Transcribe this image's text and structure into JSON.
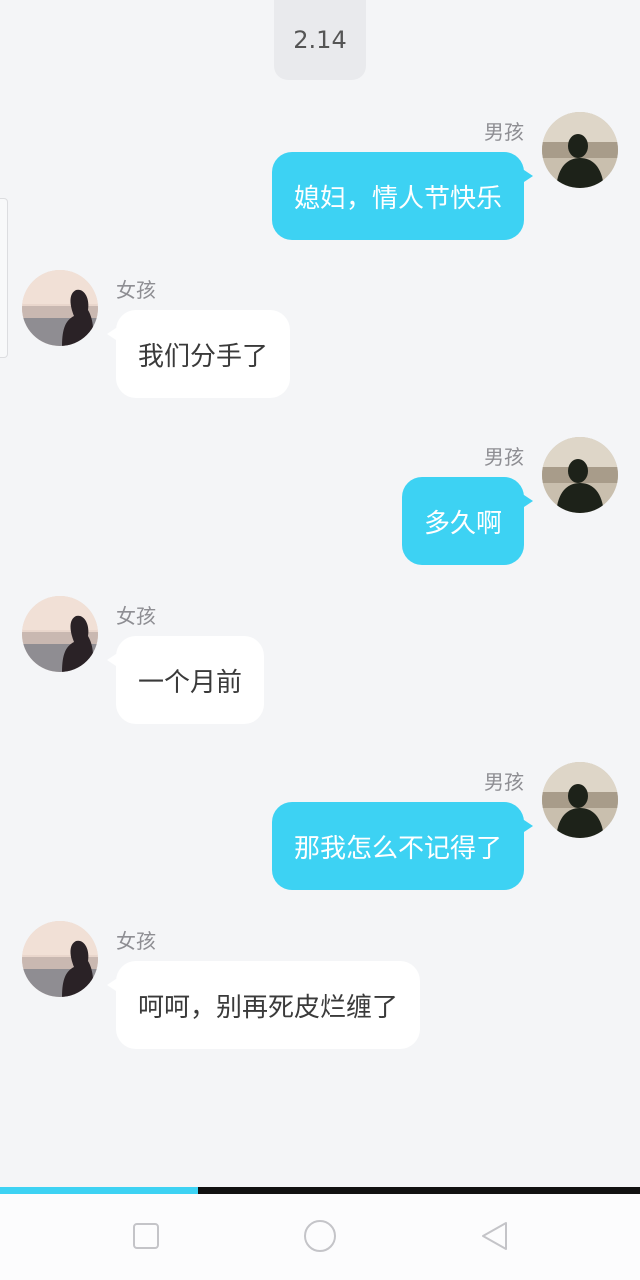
{
  "date_chip": "2.14",
  "messages": [
    {
      "side": "out",
      "sender": "男孩",
      "text": "媳妇，情人节快乐",
      "avatar": "boy-avatar"
    },
    {
      "side": "in",
      "sender": "女孩",
      "text": "我们分手了",
      "avatar": "girl-avatar"
    },
    {
      "side": "out",
      "sender": "男孩",
      "text": "多久啊",
      "avatar": "boy-avatar"
    },
    {
      "side": "in",
      "sender": "女孩",
      "text": "一个月前",
      "avatar": "girl-avatar"
    },
    {
      "side": "out",
      "sender": "男孩",
      "text": "那我怎么不记得了",
      "avatar": "boy-avatar"
    },
    {
      "side": "in",
      "sender": "女孩",
      "text": "呵呵，别再死皮烂缠了",
      "avatar": "girl-avatar"
    }
  ],
  "video_progress": 0.31,
  "colors": {
    "accent": "#3dd2f3",
    "background": "#f4f5f7",
    "incoming_bubble": "#ffffff"
  },
  "navbar": {
    "buttons": [
      "recents-square-icon",
      "home-circle-icon",
      "back-triangle-icon"
    ]
  }
}
